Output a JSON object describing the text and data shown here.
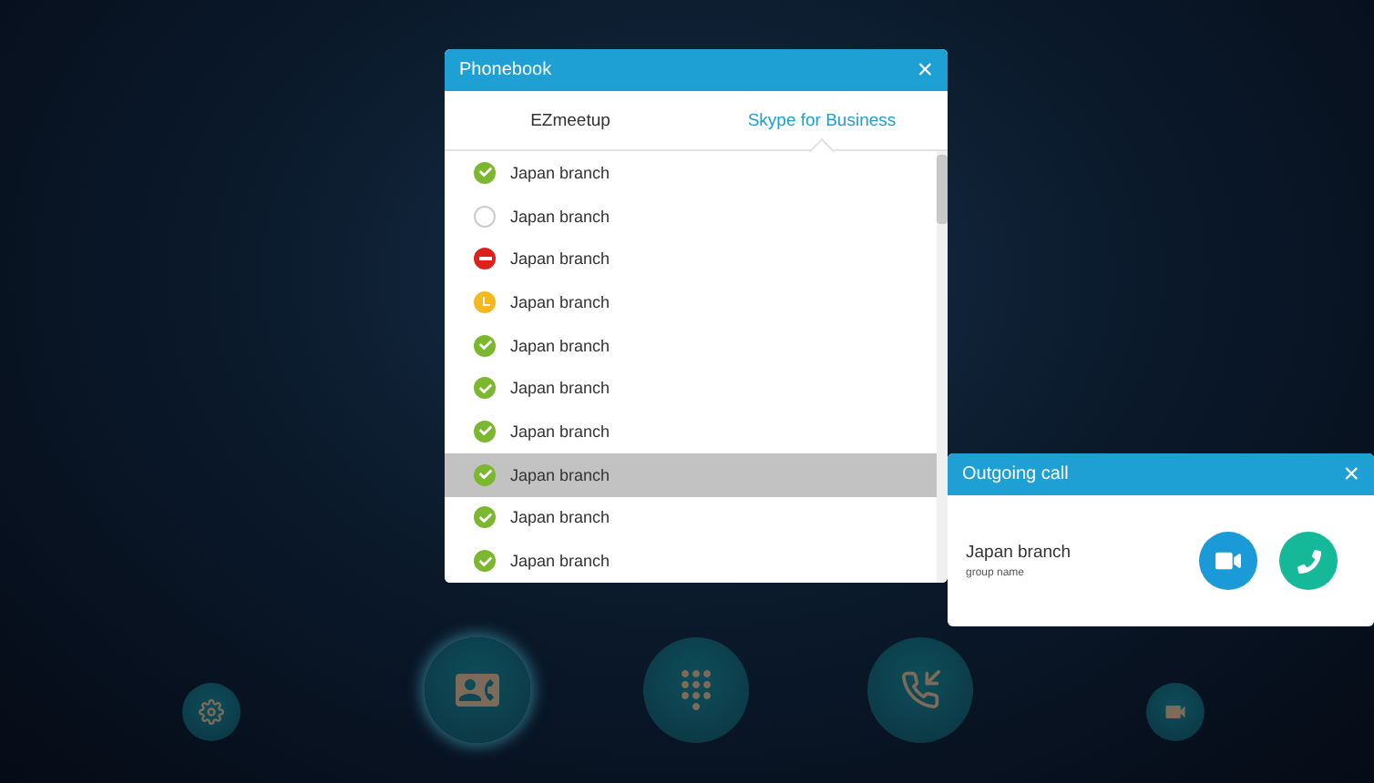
{
  "phonebook": {
    "title": "Phonebook",
    "close": "×",
    "tabs": [
      {
        "label": "EZmeetup",
        "selected": false
      },
      {
        "label": "Skype for Business",
        "selected": true
      }
    ],
    "contacts": [
      {
        "name": "Japan branch",
        "kind": "available",
        "selected": false
      },
      {
        "name": "Japan branch",
        "kind": "offline",
        "selected": false
      },
      {
        "name": "Japan branch",
        "kind": "busy",
        "selected": false
      },
      {
        "name": "Japan branch",
        "kind": "away",
        "selected": false
      },
      {
        "name": "Japan branch",
        "kind": "available",
        "selected": false
      },
      {
        "name": "Japan branch",
        "kind": "available",
        "selected": false
      },
      {
        "name": "Japan branch",
        "kind": "available",
        "selected": false
      },
      {
        "name": "Japan branch",
        "kind": "available",
        "selected": true
      },
      {
        "name": "Japan branch",
        "kind": "available",
        "selected": false
      },
      {
        "name": "Japan branch",
        "kind": "available",
        "selected": false
      }
    ]
  },
  "outgoing_call": {
    "title": "Outgoing call",
    "close": "×",
    "name": "Japan branch",
    "subtitle": "group name"
  },
  "dock": [
    {
      "kind": "settings",
      "selected": false
    },
    {
      "kind": "contacts",
      "selected": true
    },
    {
      "kind": "dialpad",
      "selected": false
    },
    {
      "kind": "calls",
      "selected": false
    },
    {
      "kind": "camera",
      "selected": false
    }
  ]
}
